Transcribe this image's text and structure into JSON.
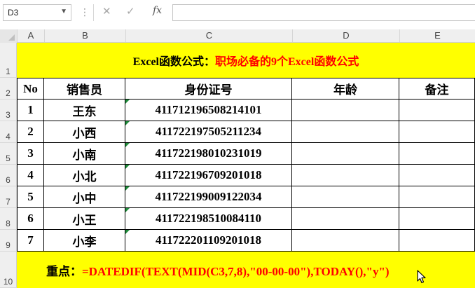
{
  "formula_bar": {
    "name_box": "D3",
    "fx_label": "fx",
    "formula_value": ""
  },
  "columns": [
    "A",
    "B",
    "C",
    "D",
    "E"
  ],
  "rows": [
    "1",
    "2",
    "3",
    "4",
    "5",
    "6",
    "7",
    "8",
    "9",
    "10"
  ],
  "title": {
    "black": "Excel函数公式：",
    "red": "职场必备的9个Excel函数公式"
  },
  "table": {
    "headers": [
      "No",
      "销售员",
      "身份证号",
      "年龄",
      "备注"
    ],
    "rows": [
      [
        "1",
        "王东",
        "411712196508214101",
        "",
        ""
      ],
      [
        "2",
        "小西",
        "411722197505211234",
        "",
        ""
      ],
      [
        "3",
        "小南",
        "411722198010231019",
        "",
        ""
      ],
      [
        "4",
        "小北",
        "411722196709201018",
        "",
        ""
      ],
      [
        "5",
        "小中",
        "411722199009122034",
        "",
        ""
      ],
      [
        "6",
        "小王",
        "411722198510084110",
        "",
        ""
      ],
      [
        "7",
        "小李",
        "411722201109201018",
        "",
        ""
      ]
    ]
  },
  "bottom_note": {
    "label": "重点：",
    "formula": "=DATEDIF(TEXT(MID(C3,7,8),\"00-00-00\"),TODAY(),\"y\")"
  },
  "colors": {
    "highlight": "#ffff00",
    "accent_red": "#ff0000",
    "comment_marker": "#1e8c3a"
  }
}
